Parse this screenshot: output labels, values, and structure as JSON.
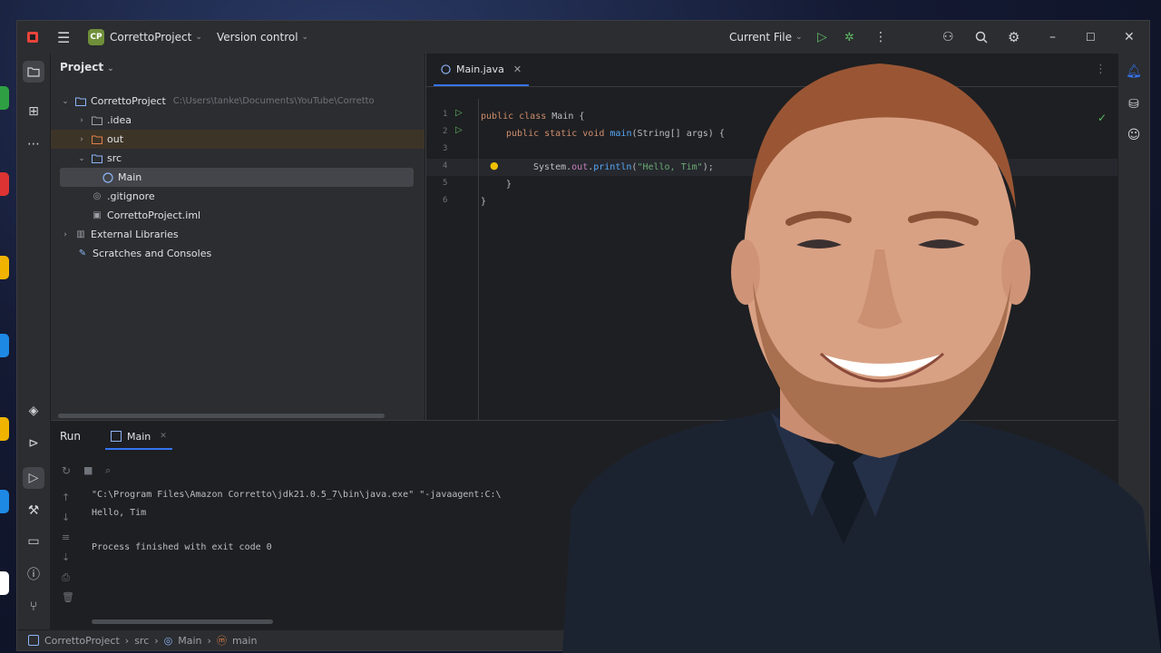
{
  "window": {
    "project_name": "CorrettoProject",
    "project_badge": "CP",
    "version_control": "Version control",
    "run_config": "Current File"
  },
  "project_panel": {
    "title": "Project",
    "root": {
      "label": "CorrettoProject",
      "path": "C:\\Users\\tanke\\Documents\\YouTube\\Corretto"
    },
    "items": [
      {
        "label": ".idea"
      },
      {
        "label": "out"
      },
      {
        "label": "src"
      },
      {
        "label": "Main"
      },
      {
        "label": ".gitignore"
      },
      {
        "label": "CorrettoProject.iml"
      },
      {
        "label": "External Libraries"
      },
      {
        "label": "Scratches and Consoles"
      }
    ]
  },
  "editor": {
    "tab_label": "Main.java",
    "line_numbers": [
      "1",
      "2",
      "3",
      "4",
      "5",
      "6"
    ],
    "code": {
      "l1_kw": "public class ",
      "l1_rest": "Main {",
      "l2_kw": "public static void ",
      "l2_fn": "main",
      "l2_rest": "(String[] args) {",
      "l4_a": "System.",
      "l4_fld": "out",
      "l4_b": ".",
      "l4_fn": "println",
      "l4_c": "(",
      "l4_str": "\"Hello, Tim\"",
      "l4_d": ");",
      "l5": "}",
      "l6": "}"
    }
  },
  "run_panel": {
    "title": "Run",
    "tab": "Main",
    "console": [
      "\"C:\\Program Files\\Amazon Corretto\\jdk21.0.5_7\\bin\\java.exe\" \"-javaagent:C:\\",
      "Hello, Tim",
      "",
      "Process finished with exit code 0"
    ]
  },
  "status_bar": {
    "crumbs": [
      "CorrettoProject",
      "src",
      "Main",
      "main"
    ]
  },
  "colors": {
    "keyword": "#cf8e6d",
    "string": "#6aab73",
    "field": "#c77dbb",
    "function": "#56a8f5",
    "accent": "#3574f0"
  }
}
